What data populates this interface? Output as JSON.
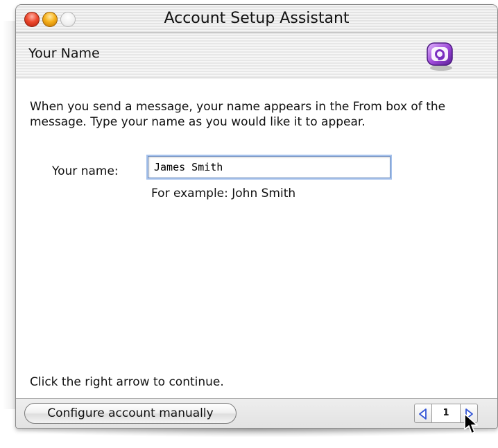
{
  "window": {
    "title": "Account Setup Assistant"
  },
  "header": {
    "title": "Your Name",
    "icon": "entourage-icon"
  },
  "body": {
    "intro": "When you send a message, your name appears in the From box of the message. Type your name as you would like it to appear.",
    "name_label": "Your name:",
    "name_value": "James Smith",
    "example": "For example: John Smith",
    "continue_hint": "Click the right arrow to continue."
  },
  "footer": {
    "configure_label": "Configure account manually",
    "page_number": "1"
  },
  "colors": {
    "close": "#ee4a2f",
    "minimize": "#f7b21b",
    "accent_focus": "#a6c2ec",
    "arrow_blue": "#3456d6",
    "icon_purple": "#8a3fc7"
  }
}
